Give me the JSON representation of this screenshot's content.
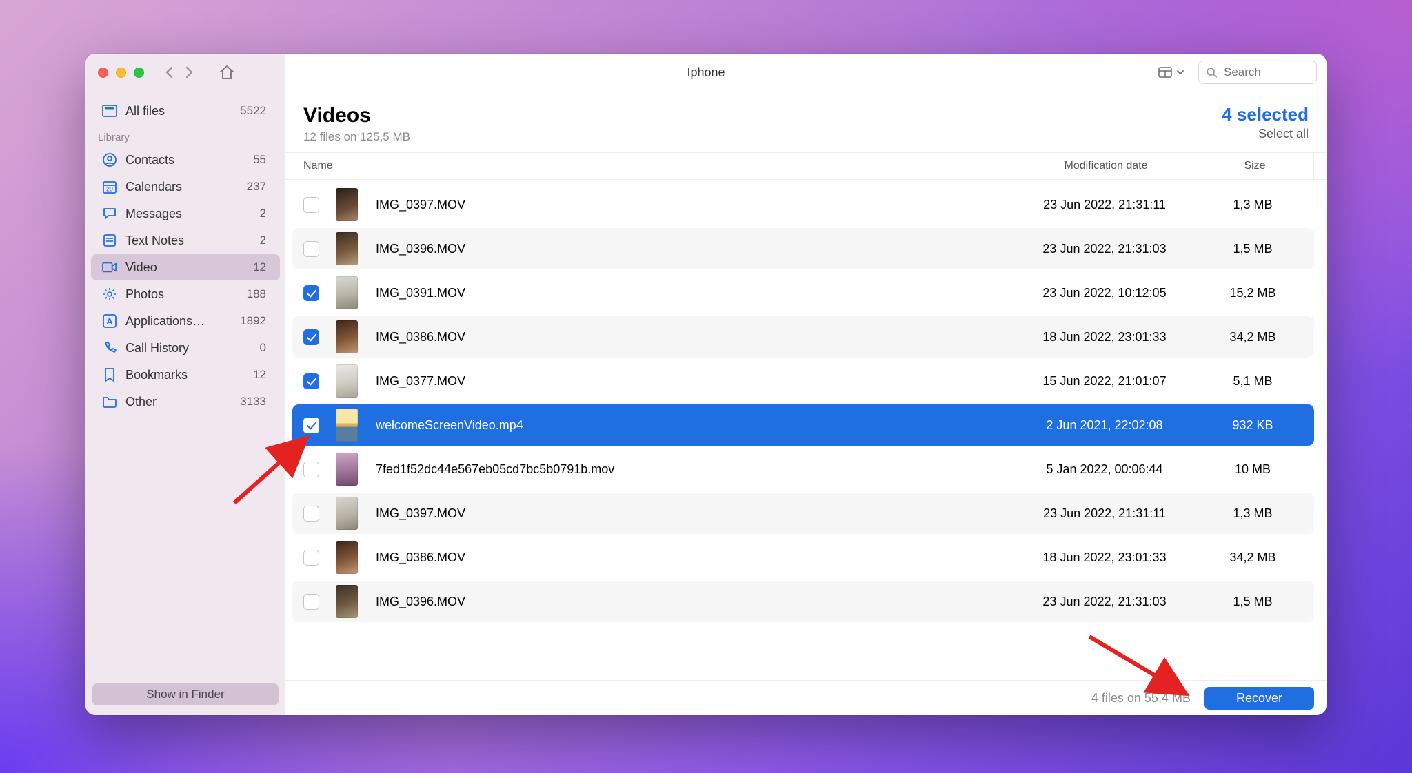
{
  "window_title": "Iphone",
  "search_placeholder": "Search",
  "sidebar": {
    "all_files": {
      "label": "All files",
      "count": "5522"
    },
    "section": "Library",
    "items": [
      {
        "id": "contacts",
        "label": "Contacts",
        "count": "55",
        "icon": "contact"
      },
      {
        "id": "calendars",
        "label": "Calendars",
        "count": "237",
        "icon": "calendar"
      },
      {
        "id": "messages",
        "label": "Messages",
        "count": "2",
        "icon": "message"
      },
      {
        "id": "textnotes",
        "label": "Text Notes",
        "count": "2",
        "icon": "note"
      },
      {
        "id": "video",
        "label": "Video",
        "count": "12",
        "icon": "video",
        "active": true
      },
      {
        "id": "photos",
        "label": "Photos",
        "count": "188",
        "icon": "photo"
      },
      {
        "id": "applications",
        "label": "Applications…",
        "count": "1892",
        "icon": "app"
      },
      {
        "id": "callhistory",
        "label": "Call History",
        "count": "0",
        "icon": "call"
      },
      {
        "id": "bookmarks",
        "label": "Bookmarks",
        "count": "12",
        "icon": "bookmark"
      },
      {
        "id": "other",
        "label": "Other",
        "count": "3133",
        "icon": "folder"
      }
    ],
    "footer": "Show in Finder"
  },
  "main": {
    "title": "Videos",
    "subtitle": "12 files on 125,5 MB",
    "selected_label": "4 selected",
    "select_all_label": "Select all",
    "columns": {
      "name": "Name",
      "mod": "Modification date",
      "size": "Size"
    },
    "rows": [
      {
        "name": "IMG_0397.MOV",
        "mod": "23 Jun 2022, 21:31:11",
        "size": "1,3 MB",
        "checked": false,
        "thumb": "a"
      },
      {
        "name": "IMG_0396.MOV",
        "mod": "23 Jun 2022, 21:31:03",
        "size": "1,5 MB",
        "checked": false,
        "thumb": "b"
      },
      {
        "name": "IMG_0391.MOV",
        "mod": "23 Jun 2022, 10:12:05",
        "size": "15,2 MB",
        "checked": true,
        "thumb": "c"
      },
      {
        "name": "IMG_0386.MOV",
        "mod": "18 Jun 2022, 23:01:33",
        "size": "34,2 MB",
        "checked": true,
        "thumb": "d"
      },
      {
        "name": "IMG_0377.MOV",
        "mod": "15 Jun 2022, 21:01:07",
        "size": "5,1 MB",
        "checked": true,
        "thumb": "e"
      },
      {
        "name": "welcomeScreenVideo.mp4",
        "mod": "2 Jun 2021, 22:02:08",
        "size": "932 KB",
        "checked": true,
        "selected": true,
        "thumb": "f"
      },
      {
        "name": "7fed1f52dc44e567eb05cd7bc5b0791b.mov",
        "mod": "5 Jan 2022, 00:06:44",
        "size": "10 MB",
        "checked": false,
        "thumb": "g"
      },
      {
        "name": "IMG_0397.MOV",
        "mod": "23 Jun 2022, 21:31:11",
        "size": "1,3 MB",
        "checked": false,
        "thumb": "h"
      },
      {
        "name": "IMG_0386.MOV",
        "mod": "18 Jun 2022, 23:01:33",
        "size": "34,2 MB",
        "checked": false,
        "thumb": "i"
      },
      {
        "name": "IMG_0396.MOV",
        "mod": "23 Jun 2022, 21:31:03",
        "size": "1,5 MB",
        "checked": false,
        "thumb": "j"
      }
    ],
    "footer_summary": "4 files on 55,4 MB",
    "recover_label": "Recover"
  },
  "thumb_styles": {
    "a": "linear-gradient(160deg,#2b1f18,#6a4b35 60%,#a5896b)",
    "b": "linear-gradient(160deg,#3a2c22,#7a5a3e 55%,#b79d80)",
    "c": "linear-gradient(170deg,#d8d8d4,#bcb9ac 50%,#8b8779)",
    "d": "linear-gradient(160deg,#3a241a,#83573a 55%,#c59a74)",
    "e": "linear-gradient(170deg,#e9e9e6,#cfccc2 55%,#a9a598)",
    "f": "linear-gradient(180deg,#f7e6a8 0 45%,#e0b24d 45% 55%,#5a7ea0 55% 100%)",
    "g": "linear-gradient(175deg,#cfa7c3,#9a6f94 60%,#6f4e6c)",
    "h": "linear-gradient(165deg,#d9d6cf,#b8b3a6 55%,#8d8779)",
    "i": "linear-gradient(160deg,#3a241a,#83573a 55%,#c59a74)",
    "j": "linear-gradient(160deg,#3a2e23,#6f5a42 55%,#a99878)"
  }
}
